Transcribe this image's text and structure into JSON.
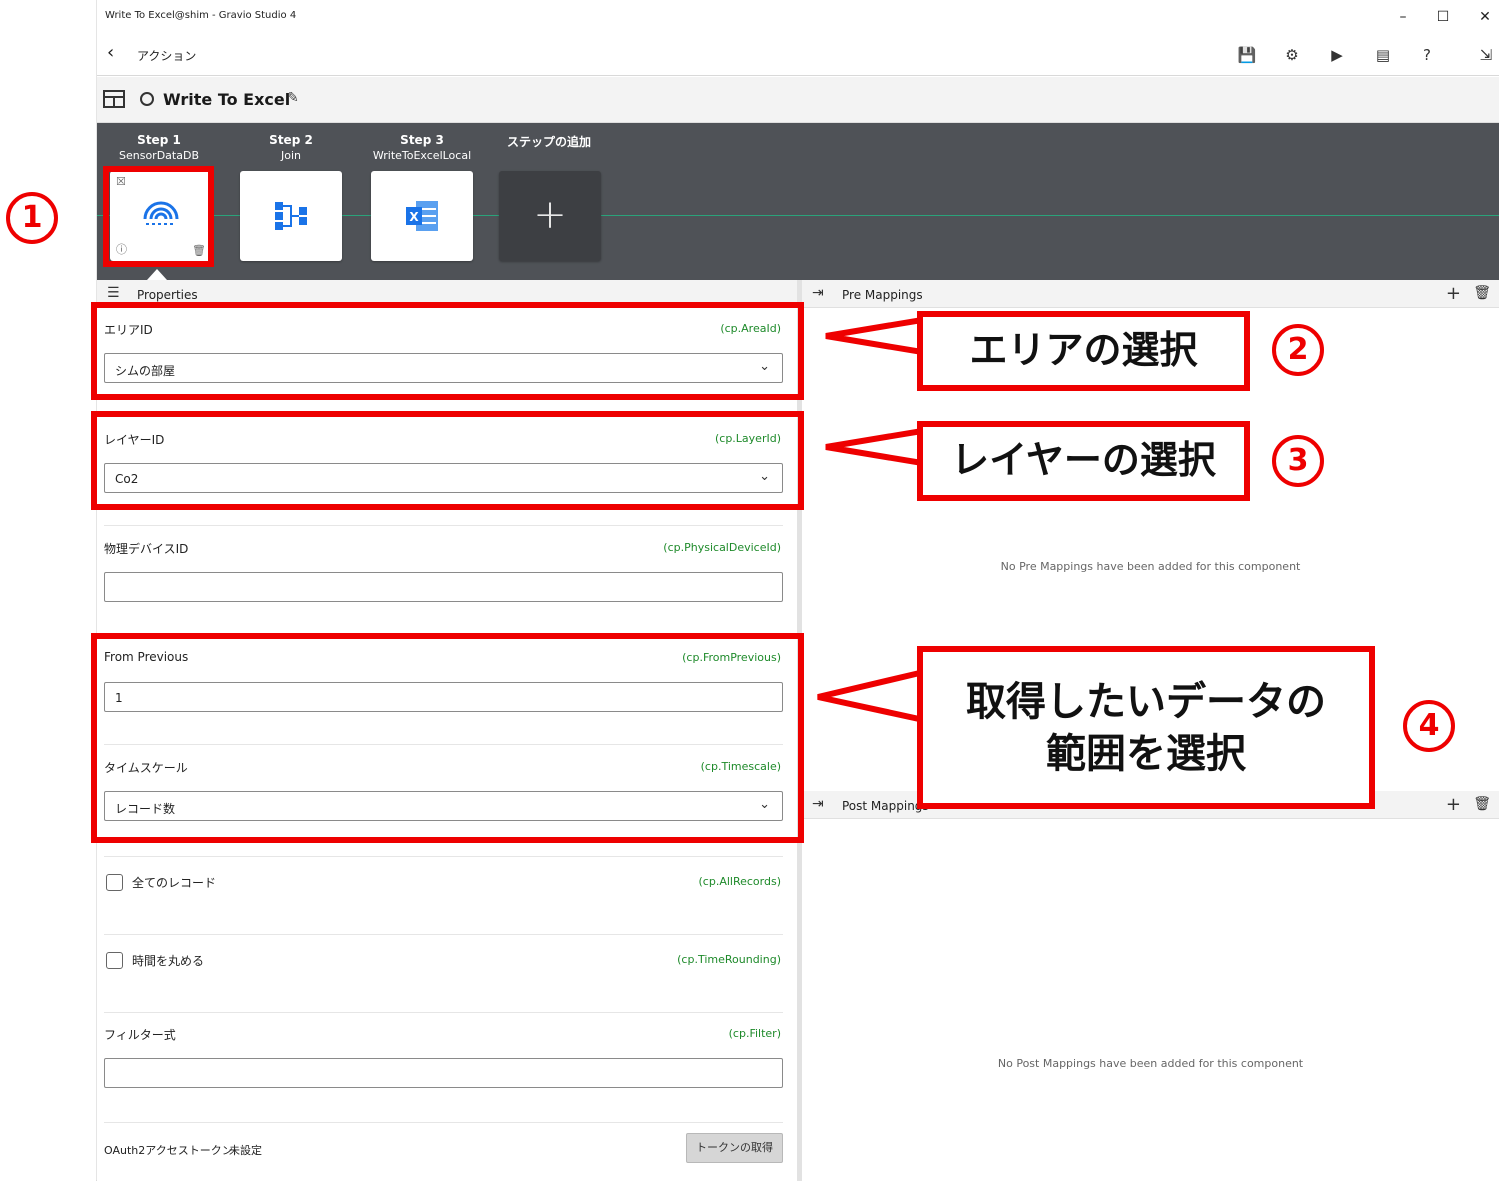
{
  "window": {
    "title": "Write To Excel@shim - Gravio Studio 4",
    "minimize_glyph": "–",
    "maximize_glyph": "☐",
    "close_glyph": "✕"
  },
  "nav": {
    "back_glyph": "‹",
    "title": "アクション",
    "tools": [
      "save-icon",
      "settings-icon",
      "play-icon",
      "log-icon",
      "help-icon",
      "exit-icon"
    ]
  },
  "component": {
    "name": "Write To Excel",
    "edit_glyph": "✎"
  },
  "steps": [
    {
      "step": "Step 1",
      "name": "SensorDataDB",
      "icon": "sensor-icon"
    },
    {
      "step": "Step 2",
      "name": "Join",
      "icon": "join-icon"
    },
    {
      "step": "Step 3",
      "name": "WriteToExcelLocal",
      "icon": "excel-icon"
    }
  ],
  "add_step": {
    "label": "ステップの追加",
    "glyph": "+"
  },
  "properties": {
    "header": "Properties",
    "area": {
      "label": "エリアID",
      "key": "(cp.AreaId)",
      "value": "シムの部屋"
    },
    "layer": {
      "label": "レイヤーID",
      "key": "(cp.LayerId)",
      "value": "Co2"
    },
    "device": {
      "label": "物理デバイスID",
      "key": "(cp.PhysicalDeviceId)",
      "value": ""
    },
    "from_previous": {
      "label": "From Previous",
      "key": "(cp.FromPrevious)",
      "value": "1"
    },
    "timescale": {
      "label": "タイムスケール",
      "key": "(cp.Timescale)",
      "value": "レコード数"
    },
    "all_records": {
      "label": "全てのレコード",
      "key": "(cp.AllRecords)"
    },
    "time_rounding": {
      "label": "時間を丸める",
      "key": "(cp.TimeRounding)"
    },
    "filter": {
      "label": "フィルター式",
      "key": "(cp.Filter)",
      "value": ""
    },
    "oauth": {
      "label": "OAuth2アクセストークン:",
      "status": "未設定",
      "button": "トークンの取得"
    }
  },
  "pre_mappings": {
    "header": "Pre Mappings",
    "empty": "No Pre Mappings have been added for this component"
  },
  "post_mappings": {
    "header": "Post Mappings",
    "empty": "No Post Mappings have been added for this component"
  },
  "annotations": {
    "n1": "1",
    "n2": "2",
    "n3": "3",
    "n4": "4",
    "c2": "エリアの選択",
    "c3": "レイヤーの選択",
    "c4_line1": "取得したいデータの",
    "c4_line2": "範囲を選択"
  },
  "colors": {
    "annotation_red": "#ee0000",
    "step_bar": "#4f5257",
    "key_green": "#1e8a2a",
    "accent_blue": "#1a73e8"
  }
}
